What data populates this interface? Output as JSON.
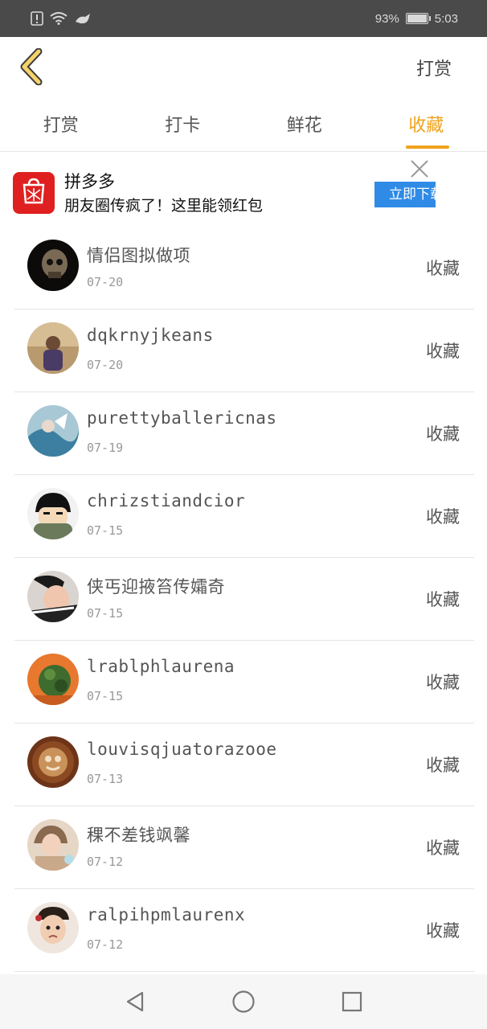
{
  "status_bar": {
    "battery_text": "93%",
    "time": "5:03",
    "battery_level": 0.93,
    "icons": [
      "alert-icon",
      "wifi-icon",
      "notification-icon"
    ]
  },
  "header": {
    "reward_label": "打赏"
  },
  "tabs": [
    {
      "label": "打赏"
    },
    {
      "label": "打卡"
    },
    {
      "label": "鲜花"
    },
    {
      "label": "收藏",
      "active": true
    }
  ],
  "ad": {
    "app_name": "拼多多",
    "text": "朋友圈传疯了！这里能领红包",
    "cta": "立即下载"
  },
  "list": [
    {
      "name": "情侣图拟做项",
      "date": "07-20",
      "action": "收藏"
    },
    {
      "name": "dqkrnyjkeans",
      "date": "07-20",
      "action": "收藏"
    },
    {
      "name": "purettyballericnas",
      "date": "07-19",
      "action": "收藏"
    },
    {
      "name": "chrizstiandcior",
      "date": "07-15",
      "action": "收藏"
    },
    {
      "name": "侠丐迎掖笞传孀奇",
      "date": "07-15",
      "action": "收藏"
    },
    {
      "name": "lrablphlaurena",
      "date": "07-15",
      "action": "收藏"
    },
    {
      "name": "louvisqjuatorazooe",
      "date": "07-13",
      "action": "收藏"
    },
    {
      "name": "稞不差钱飒馨",
      "date": "07-12",
      "action": "收藏"
    },
    {
      "name": "ralpihpmlaurenx",
      "date": "07-12",
      "action": "收藏"
    }
  ],
  "colors": {
    "accent": "#f0a21b",
    "ad_cta": "#2f8be6",
    "ad_icon": "#e02020"
  }
}
